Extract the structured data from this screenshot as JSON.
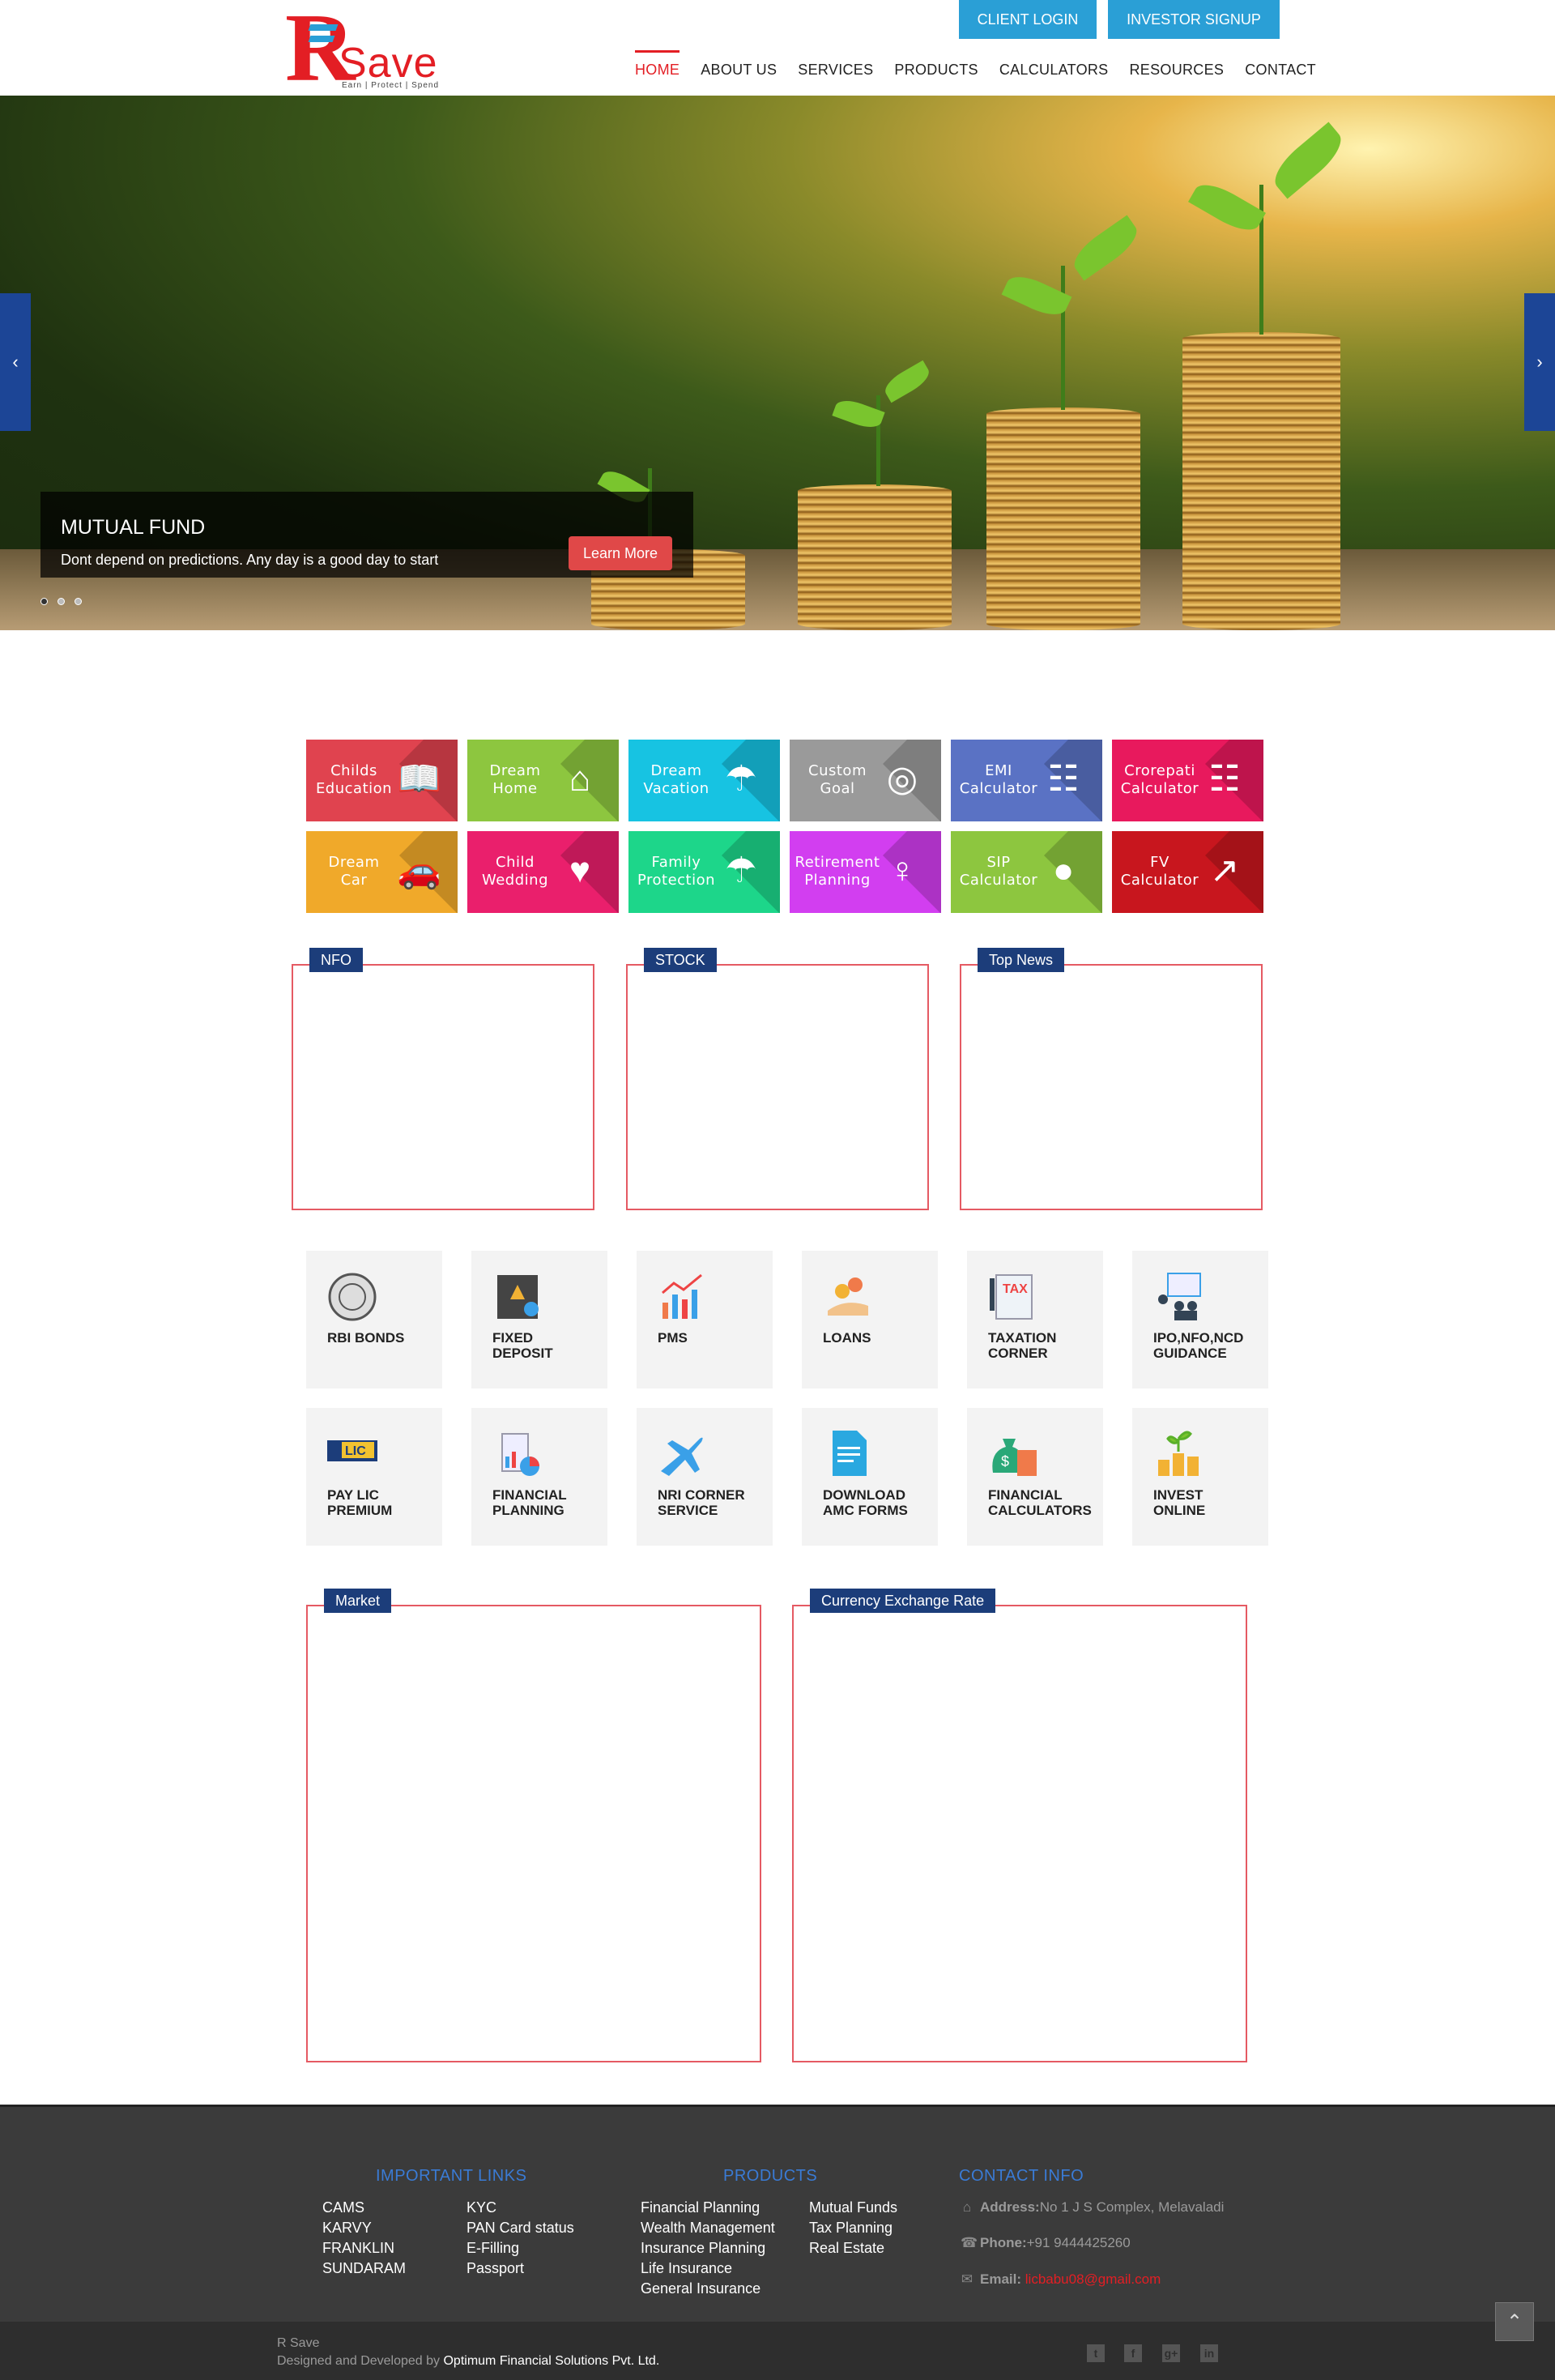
{
  "header": {
    "logo_letter": "R",
    "logo_text": "Save",
    "logo_tagline": "Earn | Protect | Spend",
    "client_login": "CLIENT LOGIN",
    "investor_signup": "INVESTOR SIGNUP",
    "nav": [
      {
        "label": "HOME",
        "active": true
      },
      {
        "label": "ABOUT US"
      },
      {
        "label": "SERVICES"
      },
      {
        "label": "PRODUCTS"
      },
      {
        "label": "CALCULATORS"
      },
      {
        "label": "RESOURCES"
      },
      {
        "label": "CONTACT"
      }
    ]
  },
  "hero": {
    "title": "MUTUAL FUND",
    "text": "Dont depend on predictions. Any day is a good day to start",
    "button": "Learn More",
    "slides": 3,
    "active_slide": 1
  },
  "tiles": [
    {
      "l1": "Childs",
      "l2": "Education",
      "color": "#e0434f",
      "icon": "reading-child-icon"
    },
    {
      "l1": "Dream",
      "l2": "Home",
      "color": "#8dc63f",
      "icon": "house-icon"
    },
    {
      "l1": "Dream",
      "l2": "Vacation",
      "color": "#17c3e2",
      "icon": "beach-umbrella-icon"
    },
    {
      "l1": "Custom",
      "l2": "Goal",
      "color": "#9a9a9a",
      "icon": "target-icon"
    },
    {
      "l1": "EMI",
      "l2": "Calculator",
      "color": "#5a72c4",
      "icon": "calculator-hand-icon"
    },
    {
      "l1": "Crorepati",
      "l2": "Calculator",
      "color": "#e8195d",
      "icon": "calculator-icon"
    },
    {
      "l1": "Dream",
      "l2": "Car",
      "color": "#f0a92a",
      "icon": "car-icon"
    },
    {
      "l1": "Child",
      "l2": "Wedding",
      "color": "#ea1f6c",
      "icon": "wedding-couple-icon"
    },
    {
      "l1": "Family",
      "l2": "Protection",
      "color": "#1dd68a",
      "icon": "family-umbrella-icon"
    },
    {
      "l1": "Retirement",
      "l2": "Planning",
      "color": "#d23ef0",
      "icon": "rocking-chair-icon"
    },
    {
      "l1": "SIP",
      "l2": "Calculator",
      "color": "#8dc63f",
      "icon": "piggy-bank-icon"
    },
    {
      "l1": "FV",
      "l2": "Calculator",
      "color": "#c8161e",
      "icon": "growth-chart-icon"
    }
  ],
  "panels_top": [
    {
      "label": "NFO"
    },
    {
      "label": "STOCK"
    },
    {
      "label": "Top News"
    }
  ],
  "services": [
    {
      "l1": "RBI BONDS",
      "l2": "",
      "icon": "rbi-seal-icon"
    },
    {
      "l1": "FIXED",
      "l2": "DEPOSIT",
      "icon": "safe-icon"
    },
    {
      "l1": "PMS",
      "l2": "",
      "icon": "bar-chart-icon"
    },
    {
      "l1": "LOANS",
      "l2": "",
      "icon": "coins-hand-icon"
    },
    {
      "l1": "TAXATION",
      "l2": "CORNER",
      "icon": "tax-icon"
    },
    {
      "l1": "IPO,NFO,NCD",
      "l2": "GUIDANCE",
      "icon": "presentation-icon"
    },
    {
      "l1": "PAY LIC",
      "l2": "PREMIUM",
      "icon": "lic-logo-icon"
    },
    {
      "l1": "FINANCIAL",
      "l2": "PLANNING",
      "icon": "report-chart-icon"
    },
    {
      "l1": "NRI CORNER",
      "l2": "SERVICE",
      "icon": "airplane-icon"
    },
    {
      "l1": "DOWNLOAD",
      "l2": "AMC FORMS",
      "icon": "document-icon"
    },
    {
      "l1": "FINANCIAL",
      "l2": "CALCULATORS",
      "icon": "money-bag-calculator-icon"
    },
    {
      "l1": "INVEST",
      "l2": "ONLINE",
      "icon": "coin-plant-icon"
    }
  ],
  "panels_bottom": [
    {
      "label": "Market"
    },
    {
      "label": "Currency Exchange Rate"
    }
  ],
  "footer": {
    "links_heading": "IMPORTANT LINKS",
    "links_col1": [
      "CAMS",
      "KARVY",
      "FRANKLIN",
      "SUNDARAM"
    ],
    "links_col2": [
      "KYC",
      "PAN Card status",
      "E-Filling",
      "Passport"
    ],
    "products_heading": "PRODUCTS",
    "products_col1": [
      "Financial Planning",
      "Wealth Management",
      "Insurance Planning",
      "Life Insurance",
      "General Insurance"
    ],
    "products_col2": [
      "Mutual Funds",
      "Tax Planning",
      "Real Estate"
    ],
    "contact_heading": "CONTACT INFO",
    "address_label": "Address:",
    "address": "No 1 J S Complex, Melavaladi",
    "phone_label": "Phone:",
    "phone": "+91 9444425260",
    "email_label": "Email:",
    "email": "licbabu08@gmail.com",
    "brand": "R Save",
    "designed_by_prefix": "Designed and Developed by",
    "designed_by": "Optimum Financial Solutions Pvt. Ltd.",
    "social": [
      "twitter-icon",
      "facebook-icon",
      "google-plus-icon",
      "linkedin-icon"
    ]
  },
  "icons": {
    "prev": "chevron-left-icon",
    "next": "chevron-right-icon",
    "to_top": "chevron-up-icon"
  }
}
